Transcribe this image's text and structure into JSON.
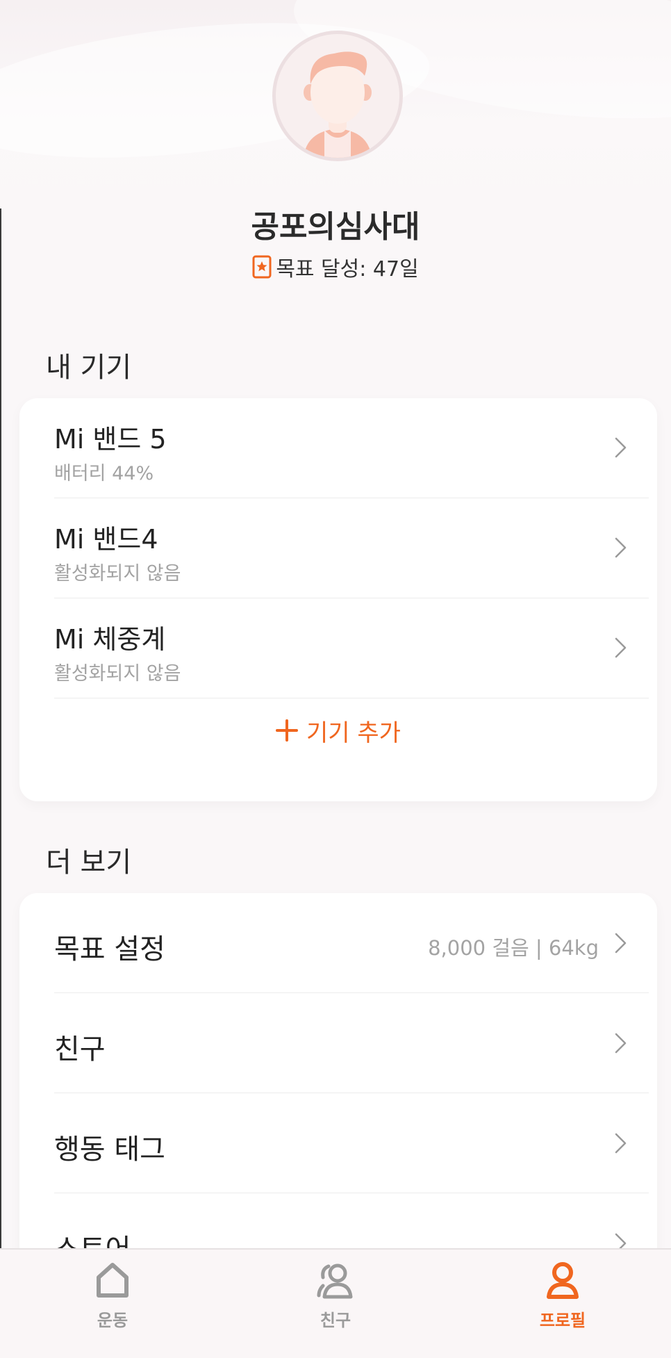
{
  "profile": {
    "name": "공포의심사대",
    "goal_text": "목표 달성: 47일"
  },
  "my_devices": {
    "title": "내 기기",
    "items": [
      {
        "name": "Mi 밴드 5",
        "status": "배터리 44%"
      },
      {
        "name": "Mi 밴드4",
        "status": "활성화되지 않음"
      },
      {
        "name": "Mi 체중계",
        "status": "활성화되지 않음"
      }
    ],
    "add_label": "기기 추가"
  },
  "more": {
    "title": "더 보기",
    "items": [
      {
        "label": "목표 설정",
        "value": "8,000 걸음 | 64kg"
      },
      {
        "label": "친구",
        "value": ""
      },
      {
        "label": "행동 태그",
        "value": ""
      },
      {
        "label": "스토어",
        "value": ""
      }
    ]
  },
  "bottom_nav": {
    "items": [
      {
        "label": "운동",
        "icon": "home-icon"
      },
      {
        "label": "친구",
        "icon": "friends-icon"
      },
      {
        "label": "프로필",
        "icon": "profile-icon"
      }
    ],
    "active": "프로필"
  },
  "colors": {
    "accent": "#f0661f",
    "text_secondary": "#a3a3a3",
    "background": "#faf7f8"
  }
}
